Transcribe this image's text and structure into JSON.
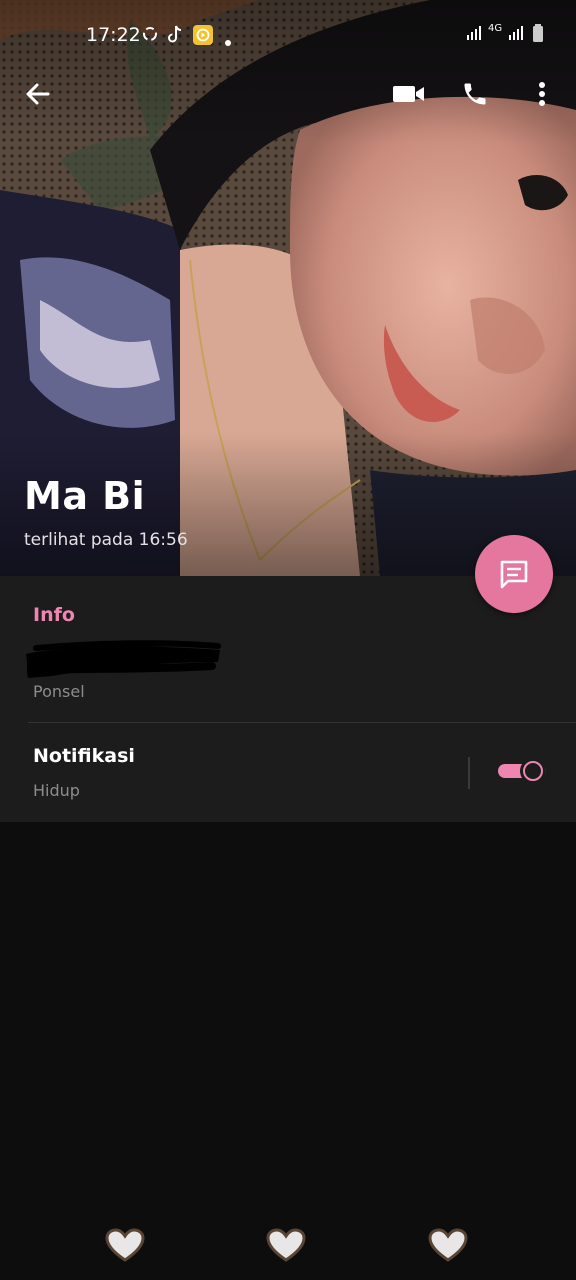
{
  "status_bar": {
    "time": "17:22",
    "network_label": "4G",
    "icons": [
      "sync-icon",
      "tiktok-icon",
      "app-notification-icon",
      "dot-icon",
      "signal-icon",
      "signal-icon",
      "battery-icon"
    ]
  },
  "toolbar": {
    "back_icon": "arrow-left-icon",
    "video_icon": "video-camera-icon",
    "call_icon": "phone-icon",
    "menu_icon": "more-vertical-icon"
  },
  "profile": {
    "name": "Ma Bi",
    "last_seen": "terlihat pada  16:56"
  },
  "info": {
    "section_title": "Info",
    "phone_label": "Ponsel",
    "notifications_title": "Notifikasi",
    "notifications_status": "Hidup",
    "notifications_enabled": true
  },
  "fab": {
    "icon": "message-icon"
  },
  "nav_hearts": [
    "heart-icon",
    "heart-icon",
    "heart-icon"
  ],
  "colors": {
    "accent": "#ef86b2",
    "fab": "#e5779e",
    "card": "#1c1c1c",
    "background": "#0d0d0d"
  }
}
